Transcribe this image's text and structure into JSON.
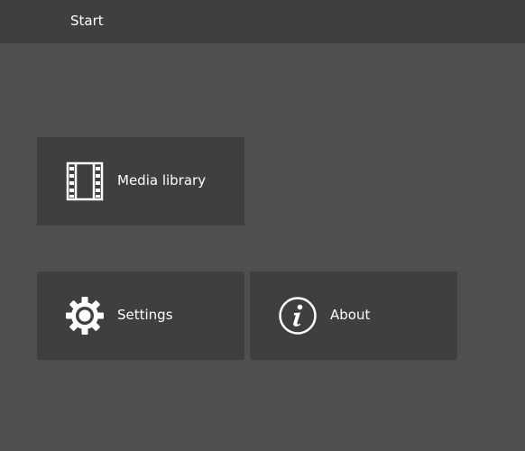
{
  "header": {
    "title": "Start"
  },
  "tiles": [
    {
      "label": "Media library",
      "icon": "film-strip-icon"
    },
    {
      "label": "Settings",
      "icon": "gear-icon"
    },
    {
      "label": "About",
      "icon": "info-icon"
    }
  ],
  "colors": {
    "background": "#4f4f4f",
    "header_background": "#3f3f3f",
    "tile_background": "#3f3f3f",
    "text": "#ffffff"
  }
}
